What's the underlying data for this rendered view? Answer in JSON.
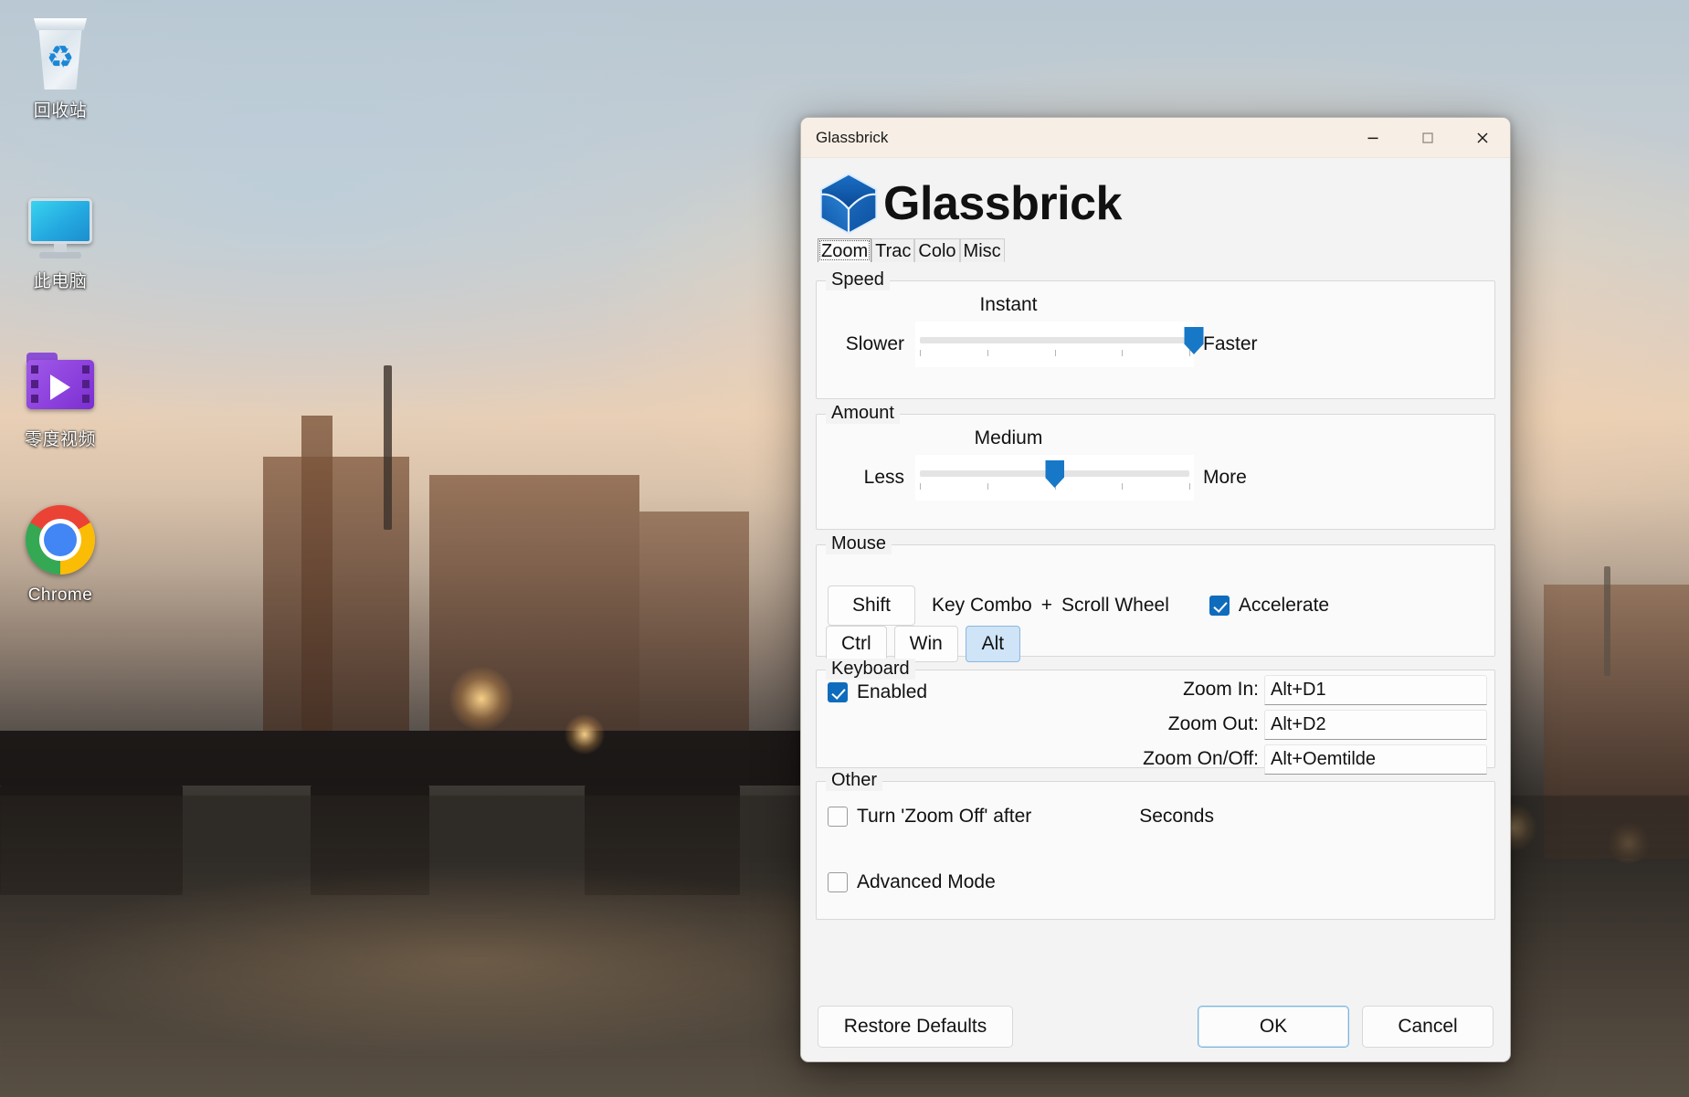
{
  "desktop": {
    "icons": [
      {
        "name": "recycle-bin",
        "label": "回收站"
      },
      {
        "name": "this-pc",
        "label": "此电脑"
      },
      {
        "name": "video-folder",
        "label": "零度视频"
      },
      {
        "name": "chrome",
        "label": "Chrome"
      }
    ]
  },
  "window": {
    "title": "Glassbrick",
    "minimize_tooltip": "Minimize",
    "maximize_tooltip": "Maximize",
    "close_tooltip": "Close"
  },
  "brand": {
    "name": "Glassbrick"
  },
  "tabs": [
    {
      "label": "Zoom",
      "active": true
    },
    {
      "label": "Trac",
      "active": false
    },
    {
      "label": "Colo",
      "active": false
    },
    {
      "label": "Misc",
      "active": false
    }
  ],
  "speed": {
    "legend": "Speed",
    "caption": "Instant",
    "min_label": "Slower",
    "max_label": "Faster",
    "value_percent": 100
  },
  "amount": {
    "legend": "Amount",
    "caption": "Medium",
    "min_label": "Less",
    "max_label": "More",
    "value_percent": 50
  },
  "mouse": {
    "legend": "Mouse",
    "modifier_display": "Shift",
    "key_combo_label": "Key Combo",
    "plus": "+",
    "scroll_wheel_label": "Scroll Wheel",
    "accelerate_label": "Accelerate",
    "accelerate_checked": true,
    "modifier_buttons": [
      {
        "label": "Ctrl",
        "selected": false
      },
      {
        "label": "Win",
        "selected": false
      },
      {
        "label": "Alt",
        "selected": true
      }
    ]
  },
  "keyboard": {
    "legend": "Keyboard",
    "enabled_label": "Enabled",
    "enabled_checked": true,
    "shortcuts": [
      {
        "label": "Zoom In:",
        "value": "Alt+D1"
      },
      {
        "label": "Zoom Out:",
        "value": "Alt+D2"
      },
      {
        "label": "Zoom On/Off:",
        "value": "Alt+Oemtilde"
      }
    ]
  },
  "other": {
    "legend": "Other",
    "turn_zoom_off_label": "Turn 'Zoom Off' after",
    "turn_zoom_off_checked": false,
    "seconds_label": "Seconds",
    "seconds_value": "",
    "advanced_mode_label": "Advanced Mode",
    "advanced_mode_checked": false
  },
  "footer": {
    "restore_label": "Restore Defaults",
    "ok_label": "OK",
    "cancel_label": "Cancel"
  },
  "colors": {
    "accent": "#0f6cbd",
    "slider_thumb": "#1878c8",
    "selected_key": "#cfe4f7",
    "titlebar": "#f7efe6",
    "window_bg": "#f3f3f3"
  }
}
